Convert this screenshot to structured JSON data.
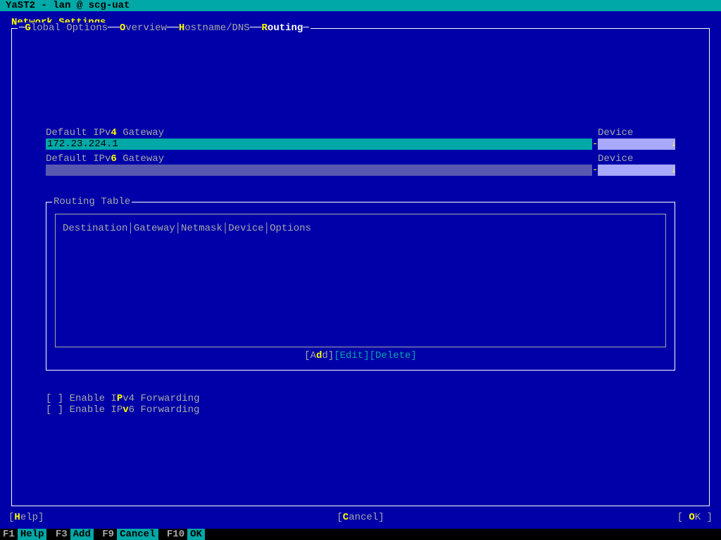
{
  "titlebar": "YaST2 - lan @ scg-uat",
  "section_title": "Network Settings",
  "tabs": {
    "global": {
      "pre": "G",
      "rest": "lobal Options"
    },
    "overview": {
      "pre": "O",
      "rest": "verview"
    },
    "hostname": {
      "pre": "H",
      "rest": "ostname/DNS"
    },
    "routing": {
      "pre": "R",
      "rest": "outing"
    }
  },
  "ipv4": {
    "label_pre": "Default IPv",
    "hot": "4",
    "label_post": " Gateway",
    "value": "172.23.224.1",
    "device_label": "Device"
  },
  "ipv6": {
    "label_pre": "Default IPv",
    "hot": "6",
    "label_post": " Gateway",
    "value": "",
    "device_label": "Device"
  },
  "routing_table": {
    "title": "Routing Table",
    "headers": [
      "Destination",
      "Gateway",
      "Netmask",
      "Device",
      "Options"
    ],
    "buttons": {
      "add": {
        "pre": "A",
        "mid": "d",
        "post": "d"
      },
      "edit": {
        "label": "[Edit]"
      },
      "delete": {
        "label": "[Delete]"
      }
    }
  },
  "checkboxes": {
    "ipv4_fwd": {
      "state": "[ ]",
      "pre": " Enable I",
      "hot": "P",
      "post": "v4 Forwarding"
    },
    "ipv6_fwd": {
      "state": "[ ]",
      "pre": " Enable IP",
      "hot": "v",
      "post": "6 Forwarding"
    }
  },
  "bottom": {
    "help": {
      "b1": "[",
      "hot": "H",
      "rest": "elp]"
    },
    "cancel": {
      "b1": "[",
      "hot": "C",
      "rest": "ancel]"
    },
    "ok": {
      "b1": "[ ",
      "hot": "O",
      "rest": "K ]"
    }
  },
  "fkeys": [
    {
      "key": "F1",
      "label": "Help"
    },
    {
      "key": "F3",
      "label": "Add"
    },
    {
      "key": "F9",
      "label": "Cancel"
    },
    {
      "key": "F10",
      "label": "OK"
    }
  ]
}
